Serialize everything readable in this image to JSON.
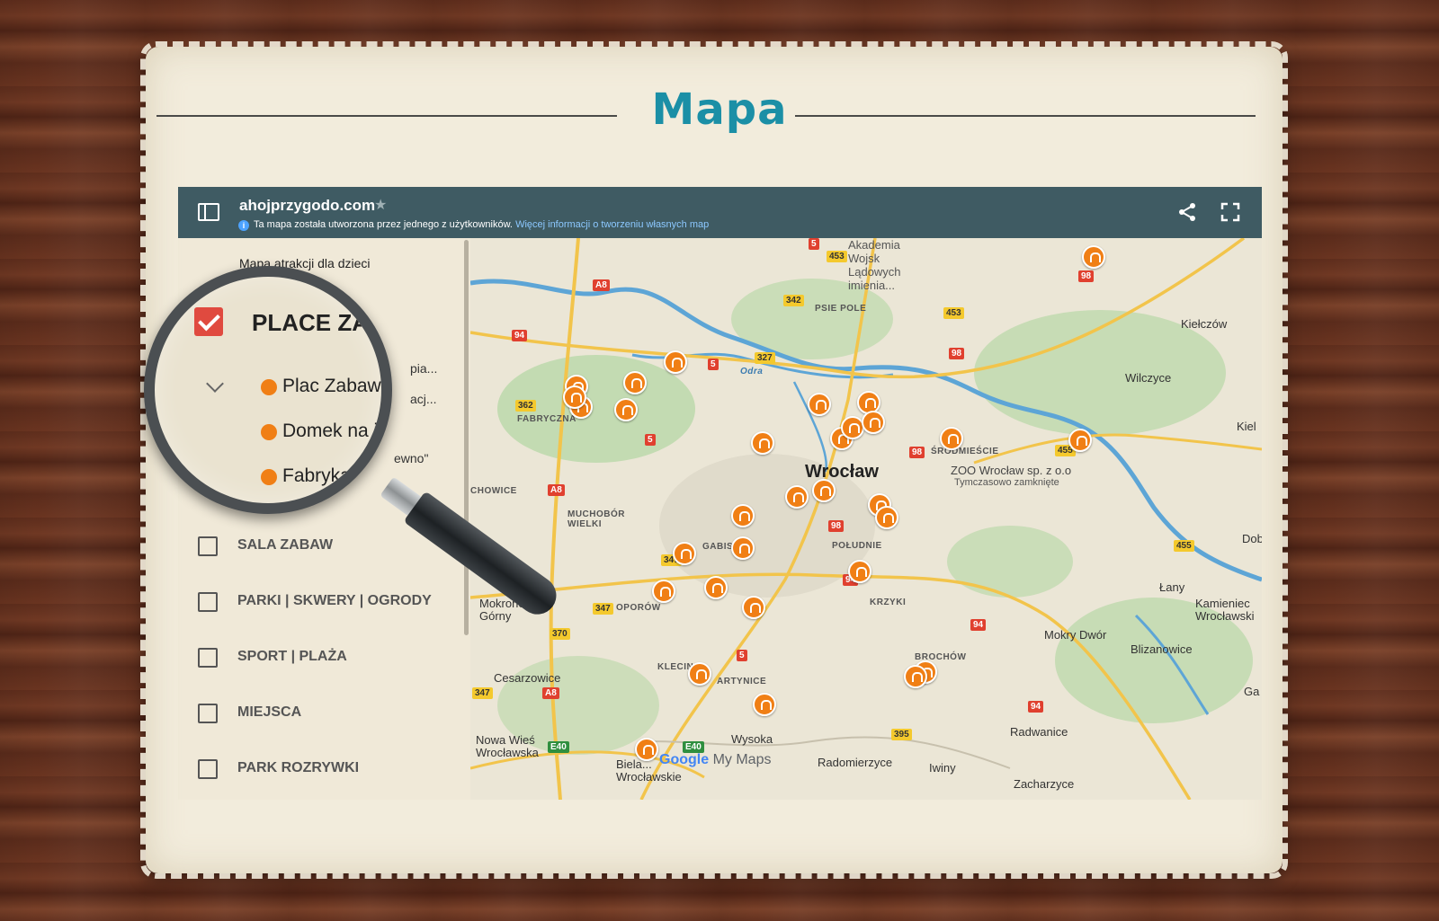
{
  "page": {
    "title": "Mapa"
  },
  "header": {
    "title": "ahojprzygodo.com",
    "info_text": "Ta mapa została utworzona przez jednego z użytkowników.",
    "info_link": "Więcej informacji o tworzeniu własnych map"
  },
  "sidebar": {
    "subtitle": "Mapa atrakcji dla dzieci",
    "categories": [
      {
        "label": "PLACE ZABAW",
        "checked": true
      },
      {
        "label": "SALA ZABAW",
        "checked": false
      },
      {
        "label": "PARKI | SKWERY | OGRODY",
        "checked": false
      },
      {
        "label": "SPORT | PLAŻA",
        "checked": false
      },
      {
        "label": "MIEJSCA",
        "checked": false
      },
      {
        "label": "PARK ROZRYWKI",
        "checked": false
      }
    ],
    "items": [
      {
        "label": "Plac Zabaw ..."
      },
      {
        "label": "Domek na je..."
      },
      {
        "label": "Fabryka n..."
      }
    ],
    "fragments": [
      "pia...",
      "acj...",
      "ewno\""
    ]
  },
  "magnifier": {
    "category_label": "PLACE ZAB",
    "items": [
      "Plac Zabaw z",
      "Domek na je",
      "Fabryka n"
    ]
  },
  "map": {
    "labels": {
      "city": "Wrocław",
      "zoo": "ZOO Wrocław sp. z o.o",
      "zoo_status": "Tymczasowo zamknięte",
      "akademia": "Akademia Wojsk Lądowych imienia...",
      "kielczow": "Kiełczów",
      "wilczyce": "Wilczyce",
      "kiel": "Kiel",
      "psie_pole": "PSIE POLE",
      "fabryczna": "FABRYCZNA",
      "srodmiescie": "ŚRÓDMIEŚCIE",
      "chowice": "CHOWICE",
      "muchobor": "MUCHOBÓR WIELKI",
      "poludnie": "POŁUDNIE",
      "gabiszyn": "GABISZYN",
      "mokronos": "Mokronos Górny",
      "oporow": "OPORÓW",
      "krzyki": "KRZYKI",
      "lany": "Łany",
      "kamieniec": "Kamieniec Wrocławski",
      "mokry_dwor": "Mokry Dwór",
      "blizanowice": "Blizanowice",
      "brochow": "BROCHÓW",
      "cesarzowice": "Cesarzowice",
      "klecina": "KLECINA",
      "partynice": "ARTYNICE",
      "ga": "Ga",
      "radwanice": "Radwanice",
      "nowa_wies": "Nowa Wieś Wrocławska",
      "wysoka": "Wysoka",
      "radomierzyce": "Radomierzyce",
      "iwiny": "Iwiny",
      "zacharzyce": "Zacharzyce",
      "bielany": "Biela... Wrocławskie",
      "dob": "Dob",
      "odra": "Odra"
    },
    "roads": [
      "5",
      "453",
      "98",
      "A8",
      "342",
      "453",
      "94",
      "327",
      "98",
      "362",
      "5",
      "98",
      "455",
      "A8",
      "98",
      "455",
      "347",
      "5",
      "94",
      "347",
      "370",
      "94",
      "5",
      "347",
      "A8",
      "94",
      "395",
      "E40",
      "E40"
    ],
    "attribution": {
      "google": "Google",
      "maps": "My Maps"
    },
    "colors": {
      "pin": "#f07f15",
      "water": "#5da5d6",
      "park": "#9ccf8c",
      "road_major": "#f2c44b"
    }
  },
  "colors": {
    "title": "#1b8fa6",
    "header_bg": "#3f5b63",
    "checkbox_checked": "#e04a3f"
  }
}
